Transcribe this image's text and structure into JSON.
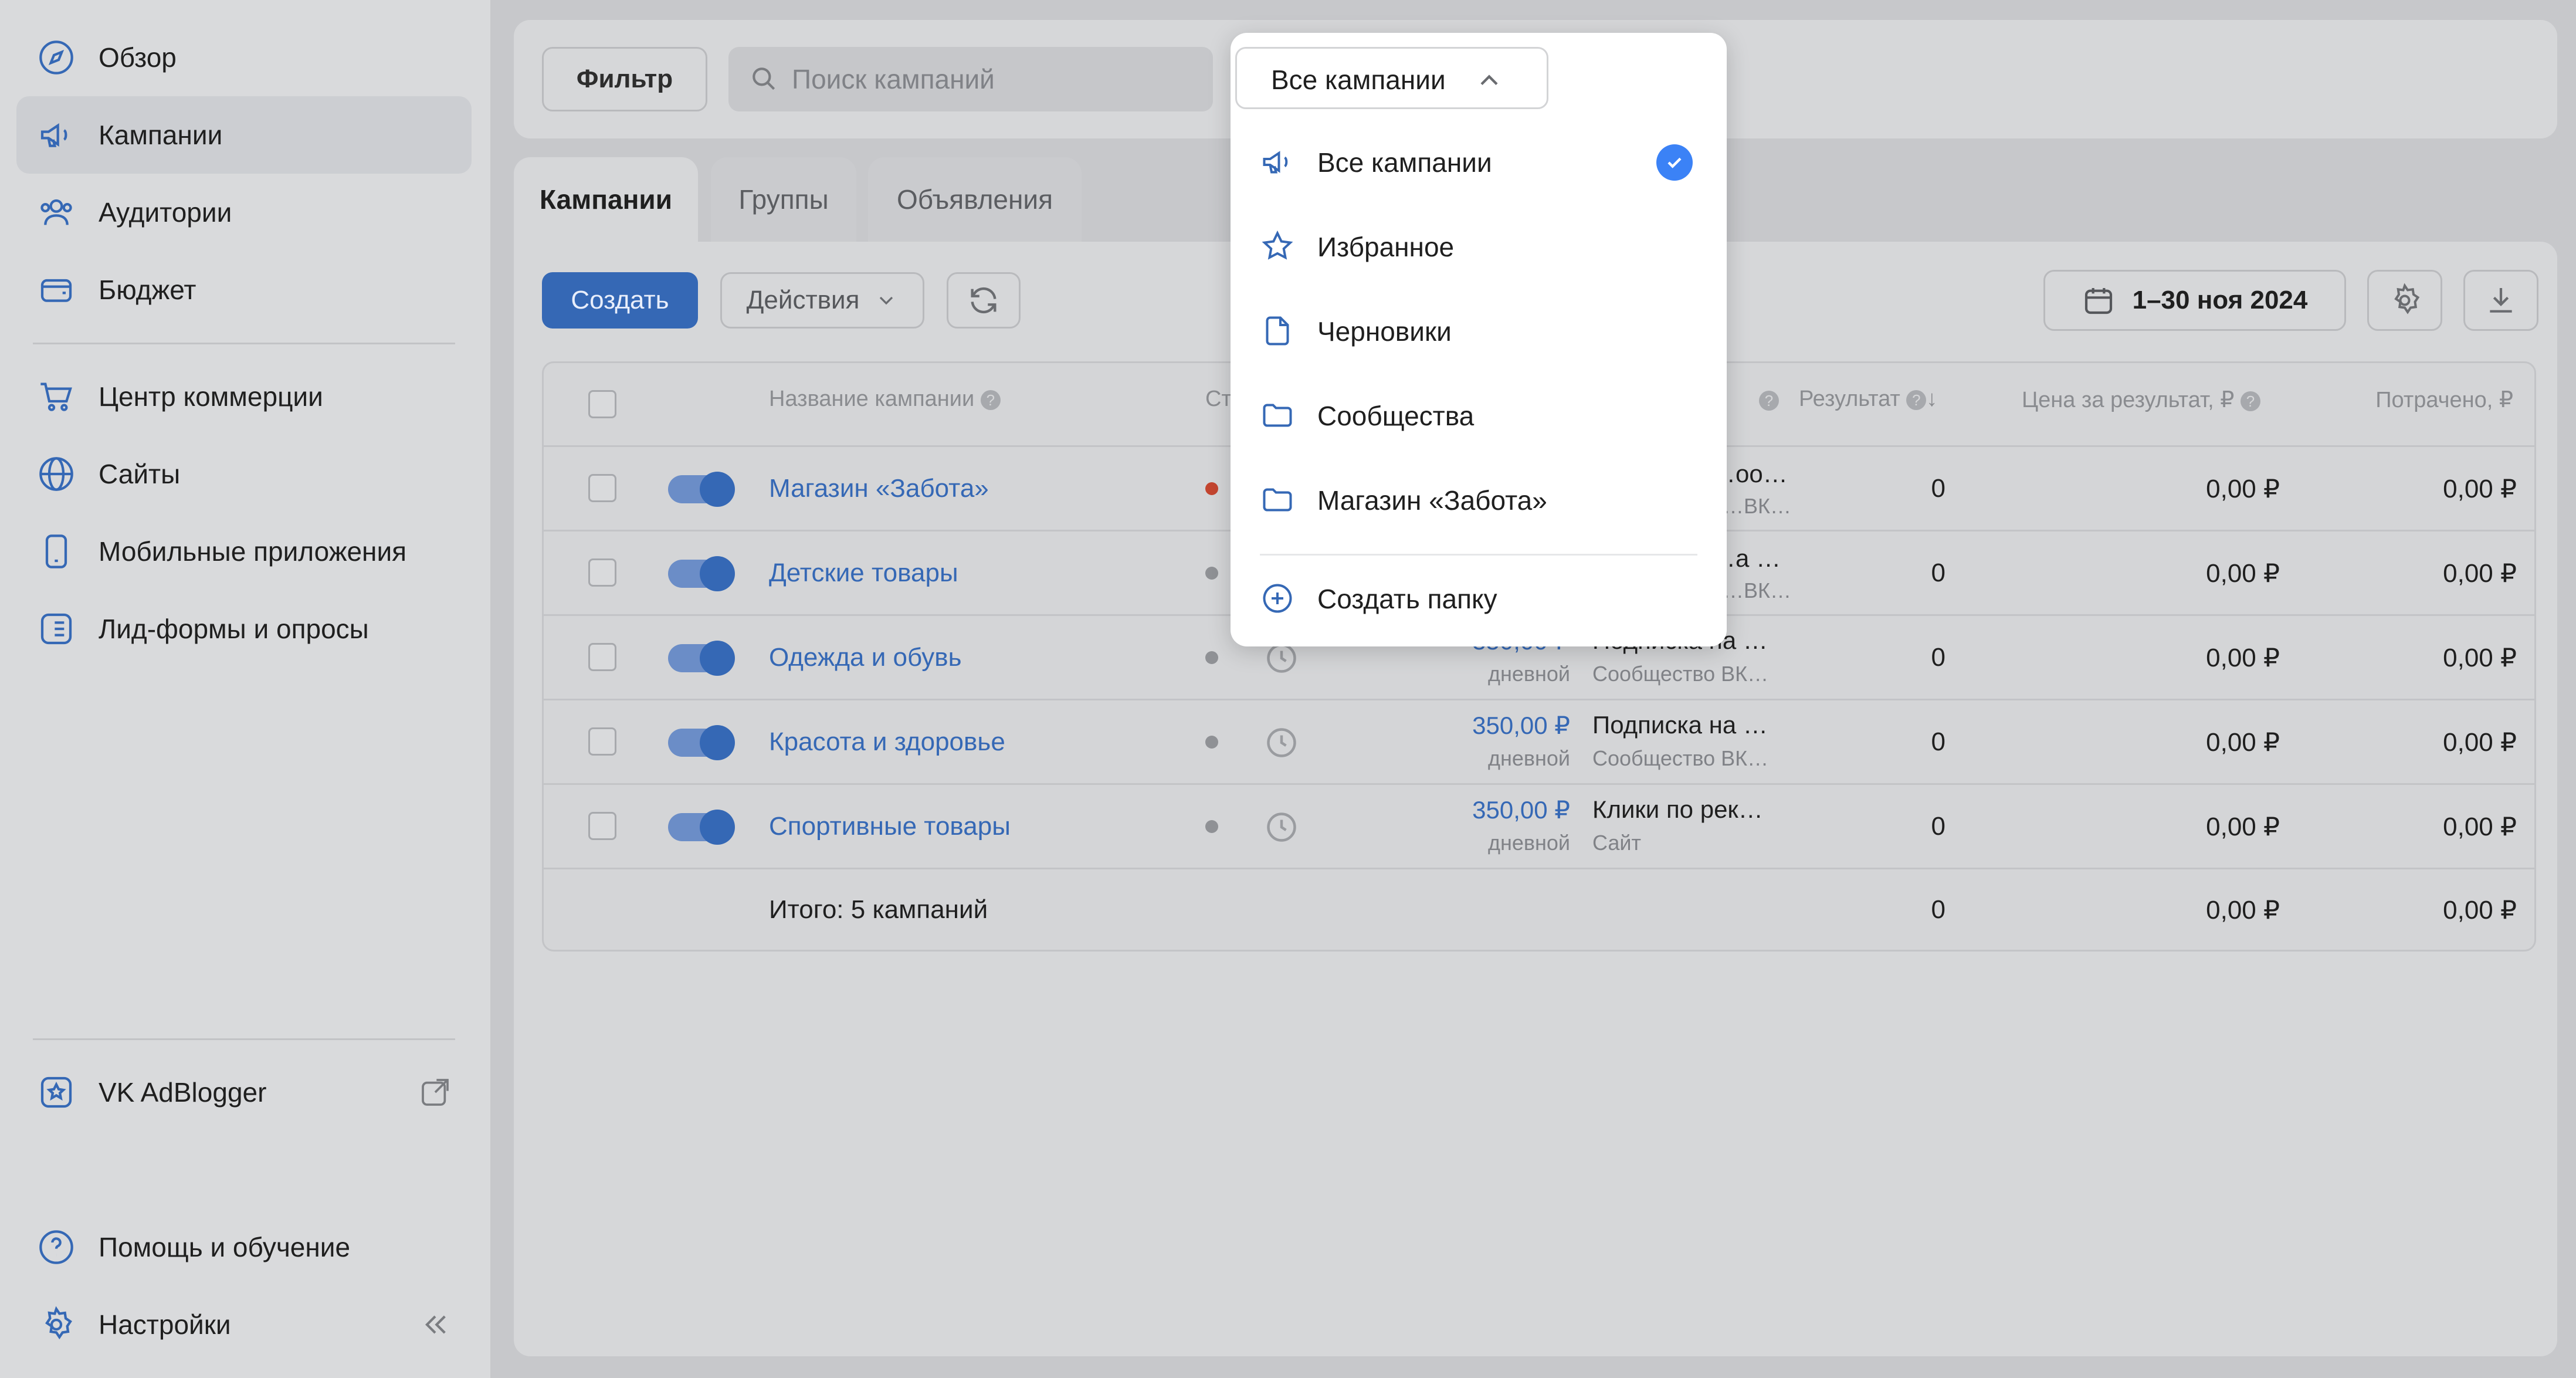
{
  "sidebar": {
    "items": [
      {
        "label": "Обзор",
        "icon": "compass-icon"
      },
      {
        "label": "Кампании",
        "icon": "megaphone-icon"
      },
      {
        "label": "Аудитории",
        "icon": "users-icon"
      },
      {
        "label": "Бюджет",
        "icon": "wallet-icon"
      },
      {
        "label": "Центр коммерции",
        "icon": "cart-icon"
      },
      {
        "label": "Сайты",
        "icon": "globe-icon"
      },
      {
        "label": "Мобильные приложения",
        "icon": "phone-icon"
      },
      {
        "label": "Лид-формы и опросы",
        "icon": "form-icon"
      }
    ],
    "adblogger": {
      "label": "VK AdBlogger",
      "icon": "adblogger-icon"
    },
    "help": {
      "label": "Помощь и обучение",
      "icon": "help-icon"
    },
    "settings": {
      "label": "Настройки",
      "icon": "gear-icon"
    }
  },
  "toolbar": {
    "filter_label": "Фильтр",
    "search_placeholder": "Поиск кампаний"
  },
  "tabs": [
    "Кампании",
    "Группы",
    "Объявления"
  ],
  "actions": {
    "create_label": "Создать",
    "actions_label": "Действия",
    "date_range": "1–30 ноя 2024"
  },
  "table": {
    "headers": {
      "name": "Название кампании",
      "status": "Ст",
      "result": "Результат",
      "price": "Цена за результат, ₽",
      "spent": "Потрачено, ₽"
    },
    "rows": [
      {
        "name": "Магазин «Забота»",
        "status_color": "#c3452f",
        "budget": "",
        "budget_period": "",
        "goal": "…оо…",
        "goal_sub": "…ВК…",
        "result": "0",
        "price": "0,00 ₽",
        "spent": "0,00 ₽"
      },
      {
        "name": "Детские товары",
        "status_color": "#8f9195",
        "budget": "",
        "budget_period": "",
        "goal": "…а …",
        "goal_sub": "…ВК…",
        "result": "0",
        "price": "0,00 ₽",
        "spent": "0,00 ₽"
      },
      {
        "name": "Одежда и обувь",
        "status_color": "#8f9195",
        "budget": "350,00 ₽",
        "budget_period": "дневной",
        "goal": "Подписка на …",
        "goal_sub": "Сообщество ВК…",
        "result": "0",
        "price": "0,00 ₽",
        "spent": "0,00 ₽"
      },
      {
        "name": "Красота и здоровье",
        "status_color": "#8f9195",
        "budget": "350,00 ₽",
        "budget_period": "дневной",
        "goal": "Подписка на …",
        "goal_sub": "Сообщество ВК…",
        "result": "0",
        "price": "0,00 ₽",
        "spent": "0,00 ₽"
      },
      {
        "name": "Спортивные товары",
        "status_color": "#8f9195",
        "budget": "350,00 ₽",
        "budget_period": "дневной",
        "goal": "Клики по рек…",
        "goal_sub": "Сайт",
        "result": "0",
        "price": "0,00 ₽",
        "spent": "0,00 ₽"
      }
    ],
    "total": {
      "label": "Итого: 5 кампаний",
      "result": "0",
      "price": "0,00 ₽",
      "spent": "0,00 ₽"
    }
  },
  "dropdown": {
    "trigger_label": "Все кампании",
    "items": [
      {
        "label": "Все кампании",
        "icon": "megaphone-icon",
        "selected": true
      },
      {
        "label": "Избранное",
        "icon": "star-icon",
        "selected": false
      },
      {
        "label": "Черновики",
        "icon": "document-icon",
        "selected": false
      },
      {
        "label": "Сообщества",
        "icon": "folder-icon",
        "selected": false
      },
      {
        "label": "Магазин «Забота»",
        "icon": "folder-icon",
        "selected": false
      }
    ],
    "create_folder_label": "Создать папку"
  },
  "colors": {
    "accent": "#3568b5",
    "check": "#3b82f6"
  }
}
